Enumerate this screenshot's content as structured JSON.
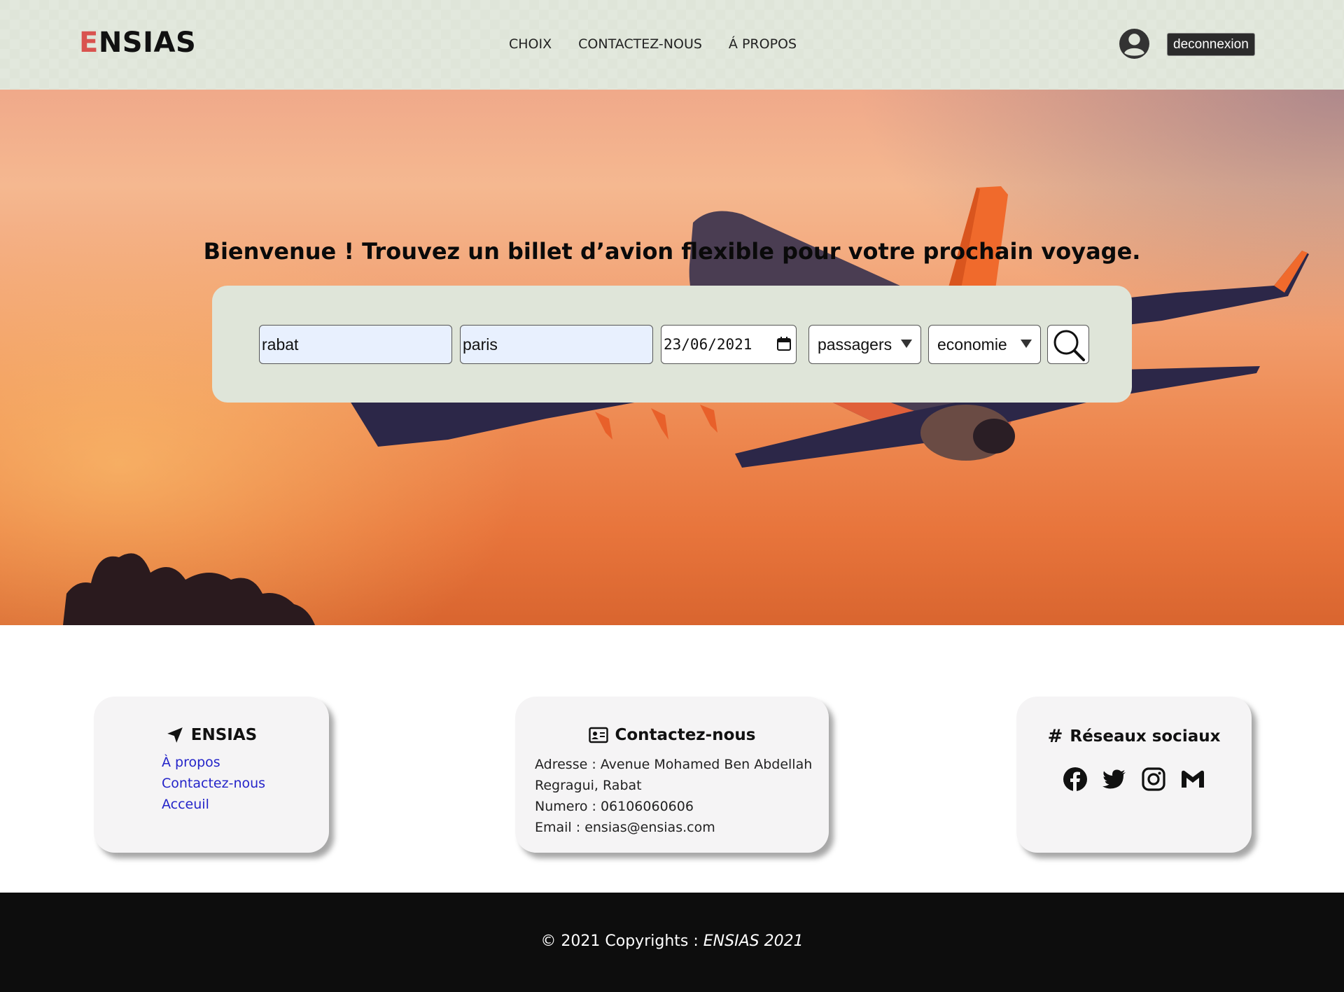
{
  "header": {
    "logo_first": "E",
    "logo_rest": "NSIAS",
    "nav": [
      "CHOIX",
      "CONTACTEZ-NOUS",
      "Á PROPOS"
    ],
    "logout_label": "deconnexion"
  },
  "hero": {
    "title": "Bienvenue ! Trouvez un billet d’avion flexible pour votre prochain voyage."
  },
  "search": {
    "from": "rabat",
    "to": "paris",
    "date": "23/06/2021",
    "passengers": "passagers",
    "class": "economie"
  },
  "cards": {
    "ensias": {
      "title": "ENSIAS",
      "links": [
        "À propos",
        "Contactez-nous",
        "Acceuil"
      ]
    },
    "contact": {
      "title": "Contactez-nous",
      "address_line1": "Adresse : Avenue Mohamed Ben Abdellah",
      "address_line2": "Regragui, Rabat",
      "phone": "Numero : 06106060606",
      "email": "Email : ensias@ensias.com"
    },
    "social": {
      "title": "Réseaux sociaux",
      "icons": [
        "facebook-icon",
        "twitter-icon",
        "instagram-icon",
        "gmail-icon"
      ]
    }
  },
  "footer": {
    "prefix": "© 2021 Copyrights : ",
    "brand": "ENSIAS 2021"
  },
  "colors": {
    "header_bg": "#dfe5d9",
    "logo_accent": "#d9534f",
    "link_blue": "#2424c9",
    "footer_bg": "#0d0d0d"
  }
}
